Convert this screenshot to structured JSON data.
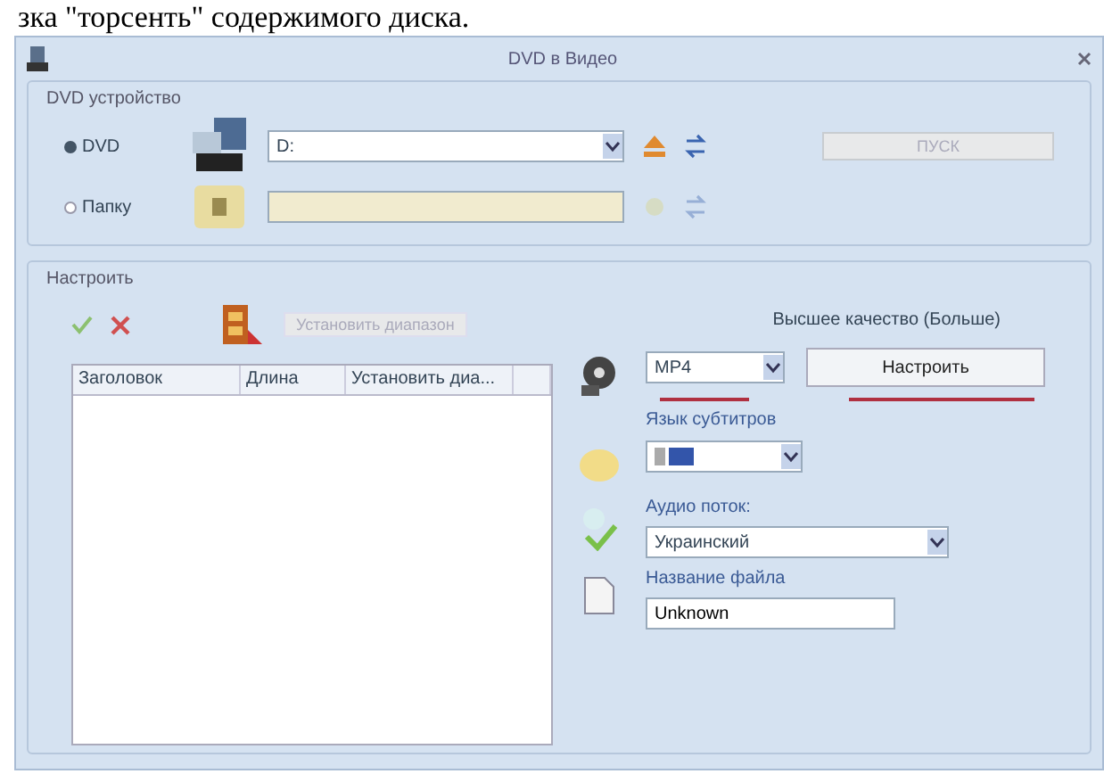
{
  "caption": "зка \"торсенть\" содержимого диска.",
  "window": {
    "title": "DVD в Видео"
  },
  "device_group": {
    "title": "DVD устройство",
    "sources": [
      {
        "label": "DVD",
        "selected": true,
        "value": "D:",
        "disabled": false
      },
      {
        "label": "Папку",
        "selected": false,
        "disabled": true
      }
    ],
    "start_button": {
      "label": "ПУСК",
      "disabled": true
    }
  },
  "settings_group": {
    "title": "Настроить",
    "range_button": {
      "label": "Установить диапазон",
      "disabled": true
    },
    "table": {
      "columns": [
        "Заголовок",
        "Длина",
        "Установить диа..."
      ]
    },
    "quality": "Высшее качество (Больше)",
    "format": {
      "value": "MP4"
    },
    "configure_button": {
      "label": "Настроить"
    },
    "subtitle_label": "Язык субтитров",
    "audio_label": "Аудио поток:",
    "audio": {
      "value": "Украинский"
    },
    "filename_label": "Название файла",
    "filename": {
      "value": "Unknown"
    }
  }
}
